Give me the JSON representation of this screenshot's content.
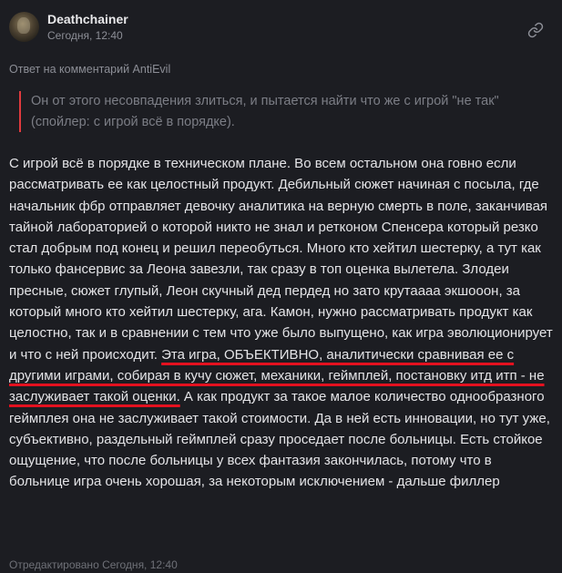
{
  "comment": {
    "author": "Deathchainer",
    "timestamp": "Сегодня, 12:40",
    "reply_to": "Ответ на комментарий AntiEvil",
    "quote": "Он от этого несовпадения злиться, и пытается найти что же с игрой \"не так\" (спойлер: с игрой всё в порядке).",
    "body_before": "С игрой всё в порядке в техническом плане. Во всем остальном она говно если рассматривать ее как целостный продукт. Дебильный сюжет начиная с посыла, где начальник фбр отправляет девочку аналитика на верную смерть в поле, заканчивая тайной лабораторией о которой никто не знал и ретконом Спенсера который резко стал добрым под конец и решил переобуться. Много кто хейтил шестерку, а тут как только фансервис за Леона завезли, так сразу в топ оценка вылетела. Злодеи пресные, сюжет глупый, Леон скучный дед пердед но зато крутаааа экшооон, за который много кто хейтил шестерку, ага. Камон, нужно рассматривать продукт как целостно, так и в сравнении с тем что уже было выпущено, как игра эволюционирует и что с ней происходит.",
    "body_highlight": "Эта игра, ОБЪЕКТИВНО, аналитически сравнивая ее с другими играми, собирая в кучу сюжет, механики, геймплей, постановку итд итп - не заслуживает такой оценки.",
    "body_after": "А как продукт за такое малое количество однообразного геймплея она не заслуживает такой стоимости. Да в ней есть инновации, но тут уже, субъективно, раздельный геймплей сразу проседает после больницы. Есть стойкое ощущение, что после больницы у всех фантазия закончилась, потому что в больнице игра очень хорошая, за некоторым исключением - дальше филлер",
    "edited": "Отредактировано Сегодня, 12:40"
  },
  "icons": {
    "link": "link-icon",
    "avatar": "user-avatar"
  },
  "colors": {
    "background": "#1c1d22",
    "quote_bar": "#e03a3e",
    "underline": "#e4111f"
  }
}
